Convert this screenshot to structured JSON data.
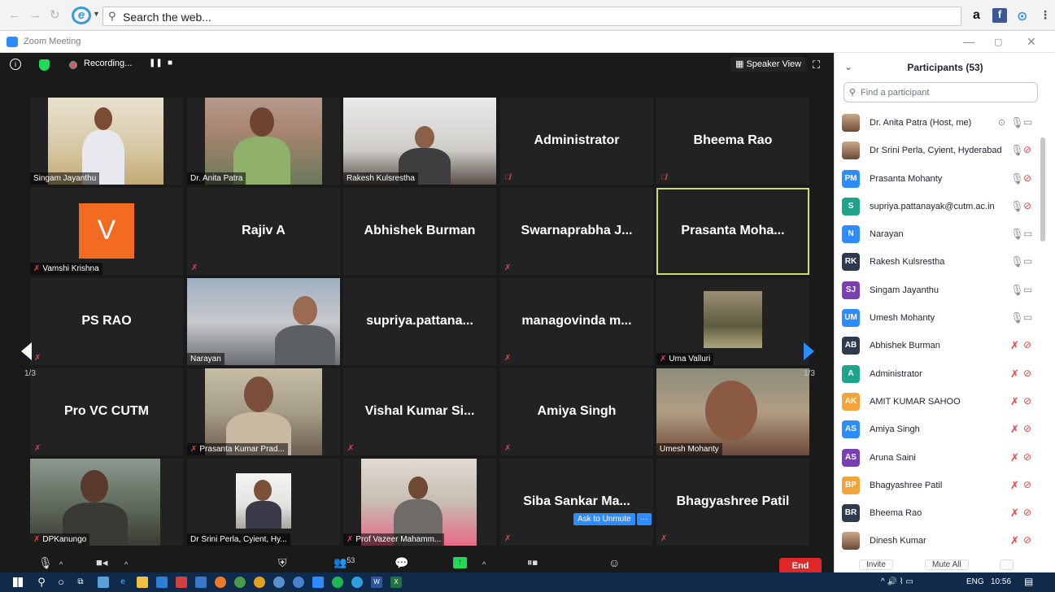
{
  "browser": {
    "search_placeholder": "Search the web...",
    "ext_a": "a",
    "ext_f": "f",
    "ext_o": "⊙"
  },
  "window": {
    "title": "Zoom Meeting"
  },
  "meeting": {
    "recording_label": "Recording...",
    "speaker_view": "Speaker View",
    "page_left": "1/3",
    "page_right": "1/3",
    "ask_to_unmute": "Ask to Unmute",
    "more": "···"
  },
  "tiles": [
    {
      "label": "Singam Jayanthu",
      "name": ""
    },
    {
      "label": "Dr. Anita Patra",
      "name": ""
    },
    {
      "label": "Rakesh Kulsrestha",
      "name": ""
    },
    {
      "label": "",
      "name": "Administrator"
    },
    {
      "label": "",
      "name": "Bheema Rao"
    },
    {
      "label": "Vamshi Krishna",
      "name": "",
      "avatar": "V"
    },
    {
      "label": "",
      "name": "Rajiv A"
    },
    {
      "label": "",
      "name": "Abhishek Burman"
    },
    {
      "label": "",
      "name": "Swarnaprabha J..."
    },
    {
      "label": "",
      "name": "Prasanta Moha..."
    },
    {
      "label": "",
      "name": "PS RAO"
    },
    {
      "label": "Narayan",
      "name": ""
    },
    {
      "label": "",
      "name": "supriya.pattana..."
    },
    {
      "label": "",
      "name": "managovinda m..."
    },
    {
      "label": "Uma Valluri",
      "name": ""
    },
    {
      "label": "",
      "name": "Pro VC CUTM"
    },
    {
      "label": "Prasanta Kumar Prad...",
      "name": ""
    },
    {
      "label": "",
      "name": "Vishal Kumar Si..."
    },
    {
      "label": "",
      "name": "Amiya Singh"
    },
    {
      "label": "Umesh Mohanty",
      "name": ""
    },
    {
      "label": "DPKanungo",
      "name": ""
    },
    {
      "label": "Dr Srini Perla, Cyient, Hy...",
      "name": ""
    },
    {
      "label": "Prof Vazeer Mahamm...",
      "name": ""
    },
    {
      "label": "",
      "name": "Siba Sankar Ma..."
    },
    {
      "label": "",
      "name": "Bhagyashree Patil"
    }
  ],
  "controls": {
    "participants_count": "53",
    "end_label": "End"
  },
  "panel": {
    "title": "Participants (53)",
    "find_placeholder": "Find a participant",
    "participants": [
      {
        "name": "Dr. Anita Patra (Host, me)",
        "initials": "",
        "color": "#c9a98c",
        "mic_off": false,
        "cam_off": false
      },
      {
        "name": "Dr Srini Perla, Cyient, Hyderabad",
        "initials": "",
        "color": "#c9a98c",
        "mic_off": false,
        "cam_off": true
      },
      {
        "name": "Prasanta Mohanty",
        "initials": "PM",
        "color": "#2d8cff",
        "mic_off": false,
        "cam_off": true
      },
      {
        "name": "supriya.pattanayak@cutm.ac.in",
        "initials": "S",
        "color": "#1fa38a",
        "mic_off": false,
        "cam_off": true
      },
      {
        "name": "Narayan",
        "initials": "N",
        "color": "#2d8cff",
        "mic_off": false,
        "cam_off": false
      },
      {
        "name": "Rakesh Kulsrestha",
        "initials": "RK",
        "color": "#2e3b4e",
        "mic_off": false,
        "cam_off": false
      },
      {
        "name": "Singam Jayanthu",
        "initials": "SJ",
        "color": "#7b3fb4",
        "mic_off": false,
        "cam_off": false
      },
      {
        "name": "Umesh Mohanty",
        "initials": "UM",
        "color": "#2d8cff",
        "mic_off": false,
        "cam_off": false
      },
      {
        "name": "Abhishek Burman",
        "initials": "AB",
        "color": "#2e3b4e",
        "mic_off": true,
        "cam_off": true
      },
      {
        "name": "Administrator",
        "initials": "A",
        "color": "#1fa38a",
        "mic_off": true,
        "cam_off": true
      },
      {
        "name": "AMIT KUMAR SAHOO",
        "initials": "AK",
        "color": "#f2a33a",
        "mic_off": true,
        "cam_off": true
      },
      {
        "name": "Amiya Singh",
        "initials": "AS",
        "color": "#2d8cff",
        "mic_off": true,
        "cam_off": true
      },
      {
        "name": "Aruna Saini",
        "initials": "AS",
        "color": "#7b3fb4",
        "mic_off": true,
        "cam_off": true
      },
      {
        "name": "Bhagyashree Patil",
        "initials": "BP",
        "color": "#f2a33a",
        "mic_off": true,
        "cam_off": true
      },
      {
        "name": "Bheema Rao",
        "initials": "BR",
        "color": "#2e3b4e",
        "mic_off": true,
        "cam_off": true
      },
      {
        "name": "Dinesh Kumar",
        "initials": "",
        "color": "#c9a98c",
        "mic_off": true,
        "cam_off": true
      }
    ],
    "invite": "Invite",
    "mute_all": "Mute All"
  },
  "taskbar": {
    "lang": "ENG",
    "time": "10:56"
  }
}
